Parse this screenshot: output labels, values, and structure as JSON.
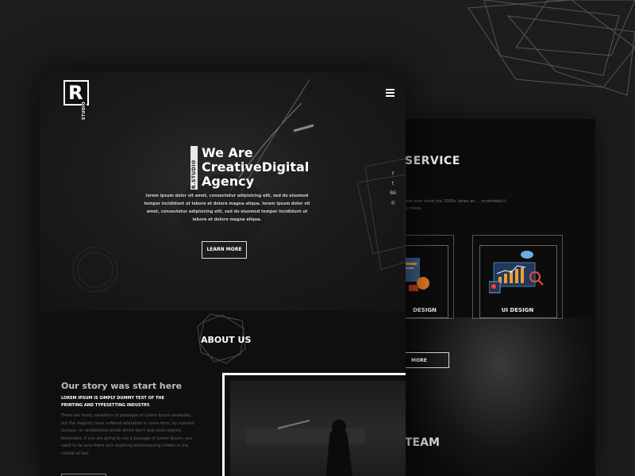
{
  "logo": {
    "letter": "R",
    "studio": "STUDIO"
  },
  "hero": {
    "vertical_tag": "R.STUDIO",
    "title_line1": "We Are",
    "title_line2": "CreativeDigital",
    "title_line3": "Agency",
    "text": "lorem ipsum dolor sit amet, consectetur adipisicing elit, sed do eiusmod tempor incididunt ut labore et dolore magna aliqua. lorem ipsum dolor sit amet, consectetur adipisicing elit, sed do eiusmod tempor incididunt ut labore et dolore magna aliqua.",
    "button": "LEARN MORE"
  },
  "social": {
    "facebook": "f",
    "twitter": "t",
    "behance": "Bē",
    "dribbble": "◎"
  },
  "about": {
    "title": "ABOUT US",
    "story_title": "Our story was start here",
    "story_sub": "LOREM IPSUM IS SIMPLY DUMMY TEXT OF THE PRINTING AND TYPESETTING INDUSTRY.",
    "story_body": "There are many variations of passages of Lorem Ipsum available, but the majority have suffered alteration in some form, by injected humour, or randomised words which don't look even slightly believable. If you are going to use a passage of Lorem Ipsum, you need to be sure there isn't anything embarrassing hidden in the middle of text"
  },
  "services": {
    "title": "SERVICE",
    "text": "text ever since the 1500s, when an ... scrambled it to make",
    "cards": [
      {
        "label": "DESIGN"
      },
      {
        "label": "UI DESIGN"
      }
    ],
    "more_button": "MORE",
    "team_title": "TEAM"
  },
  "colors": {
    "background": "#1d1d1f",
    "page": "#121213",
    "accent_orange": "#f39c33",
    "accent_blue": "#5aa9e6"
  }
}
